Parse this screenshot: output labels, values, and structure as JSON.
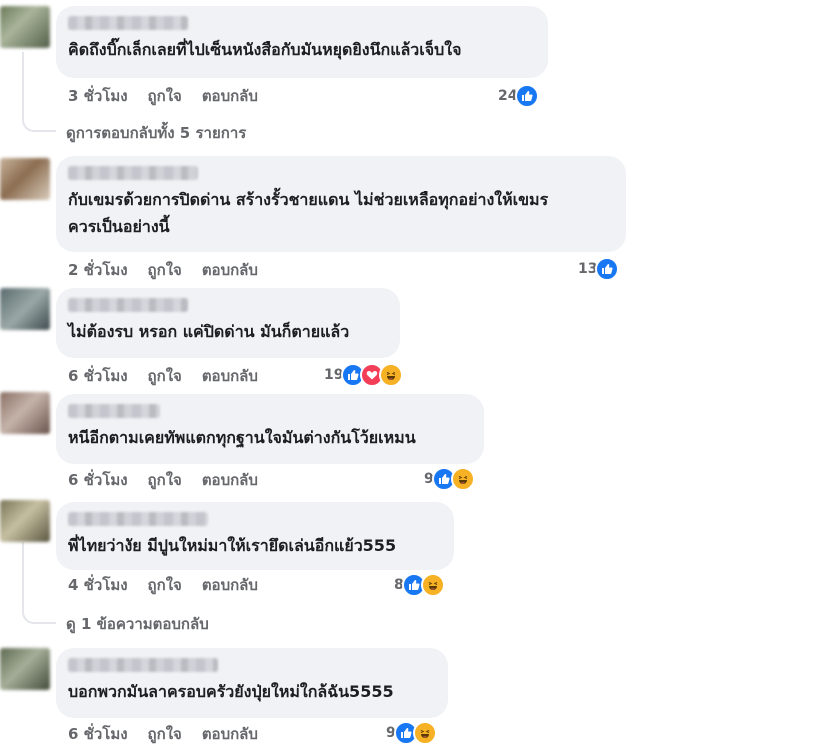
{
  "comments": [
    {
      "text_lines": [
        "คิดถึงบิ๊กเล็กเลยที่ไปเซ็นหนังสือกับมันหยุดยิงนึกแล้วเจ็บใจ"
      ],
      "time": "3 ชั่วโมง",
      "like": "ถูกใจ",
      "reply": "ตอบกลับ",
      "count": "24",
      "reactions": [
        "like-icon"
      ]
    },
    {
      "text_lines": [
        "กับเขมรด้วยการปิดด่าน สร้างรั้วชายแดน ไม่ช่วยเหลือทุกอย่างให้เขมร",
        "ควรเป็นอย่างนี้"
      ],
      "time": "2 ชั่วโมง",
      "like": "ถูกใจ",
      "reply": "ตอบกลับ",
      "count": "13",
      "reactions": [
        "like-icon"
      ]
    },
    {
      "text_lines": [
        "ไม่ต้องรบ หรอก แค่ปิดด่าน มันก็ตายแล้ว"
      ],
      "time": "6 ชั่วโมง",
      "like": "ถูกใจ",
      "reply": "ตอบกลับ",
      "count": "19",
      "reactions": [
        "like-icon",
        "love-icon",
        "haha-icon"
      ]
    },
    {
      "text_lines": [
        "หนีอีกตามเคยทัพแตกทุกฐานใจมันต่างกันโว้ยเหมน"
      ],
      "time": "6 ชั่วโมง",
      "like": "ถูกใจ",
      "reply": "ตอบกลับ",
      "count": "9",
      "reactions": [
        "like-icon",
        "haha-icon"
      ]
    },
    {
      "text_lines": [
        "พี่ไทยว่างัย มีปูนใหม่มาให้เรายึดเล่นอีกแย้ว555"
      ],
      "time": "4 ชั่วโมง",
      "like": "ถูกใจ",
      "reply": "ตอบกลับ",
      "count": "8",
      "reactions": [
        "like-icon",
        "haha-icon"
      ]
    },
    {
      "text_lines": [
        "บอกพวกมันลาครอบครัวยังปุ่ยใหม่ใกล้ฉัน5555"
      ],
      "time": "6 ชั่วโมง",
      "like": "ถูกใจ",
      "reply": "ตอบกลับ",
      "count": "9",
      "reactions": [
        "like-icon",
        "haha-icon"
      ]
    }
  ],
  "view_replies_1": "ดูการตอบกลับทั้ง 5 รายการ",
  "view_replies_2": "ดู 1 ข้อความตอบกลับ",
  "colors": {
    "like": "#1877f2",
    "love": "#f33e58",
    "haha": "#f7b125",
    "bubble": "#f0f2f5",
    "meta": "#65676b"
  }
}
